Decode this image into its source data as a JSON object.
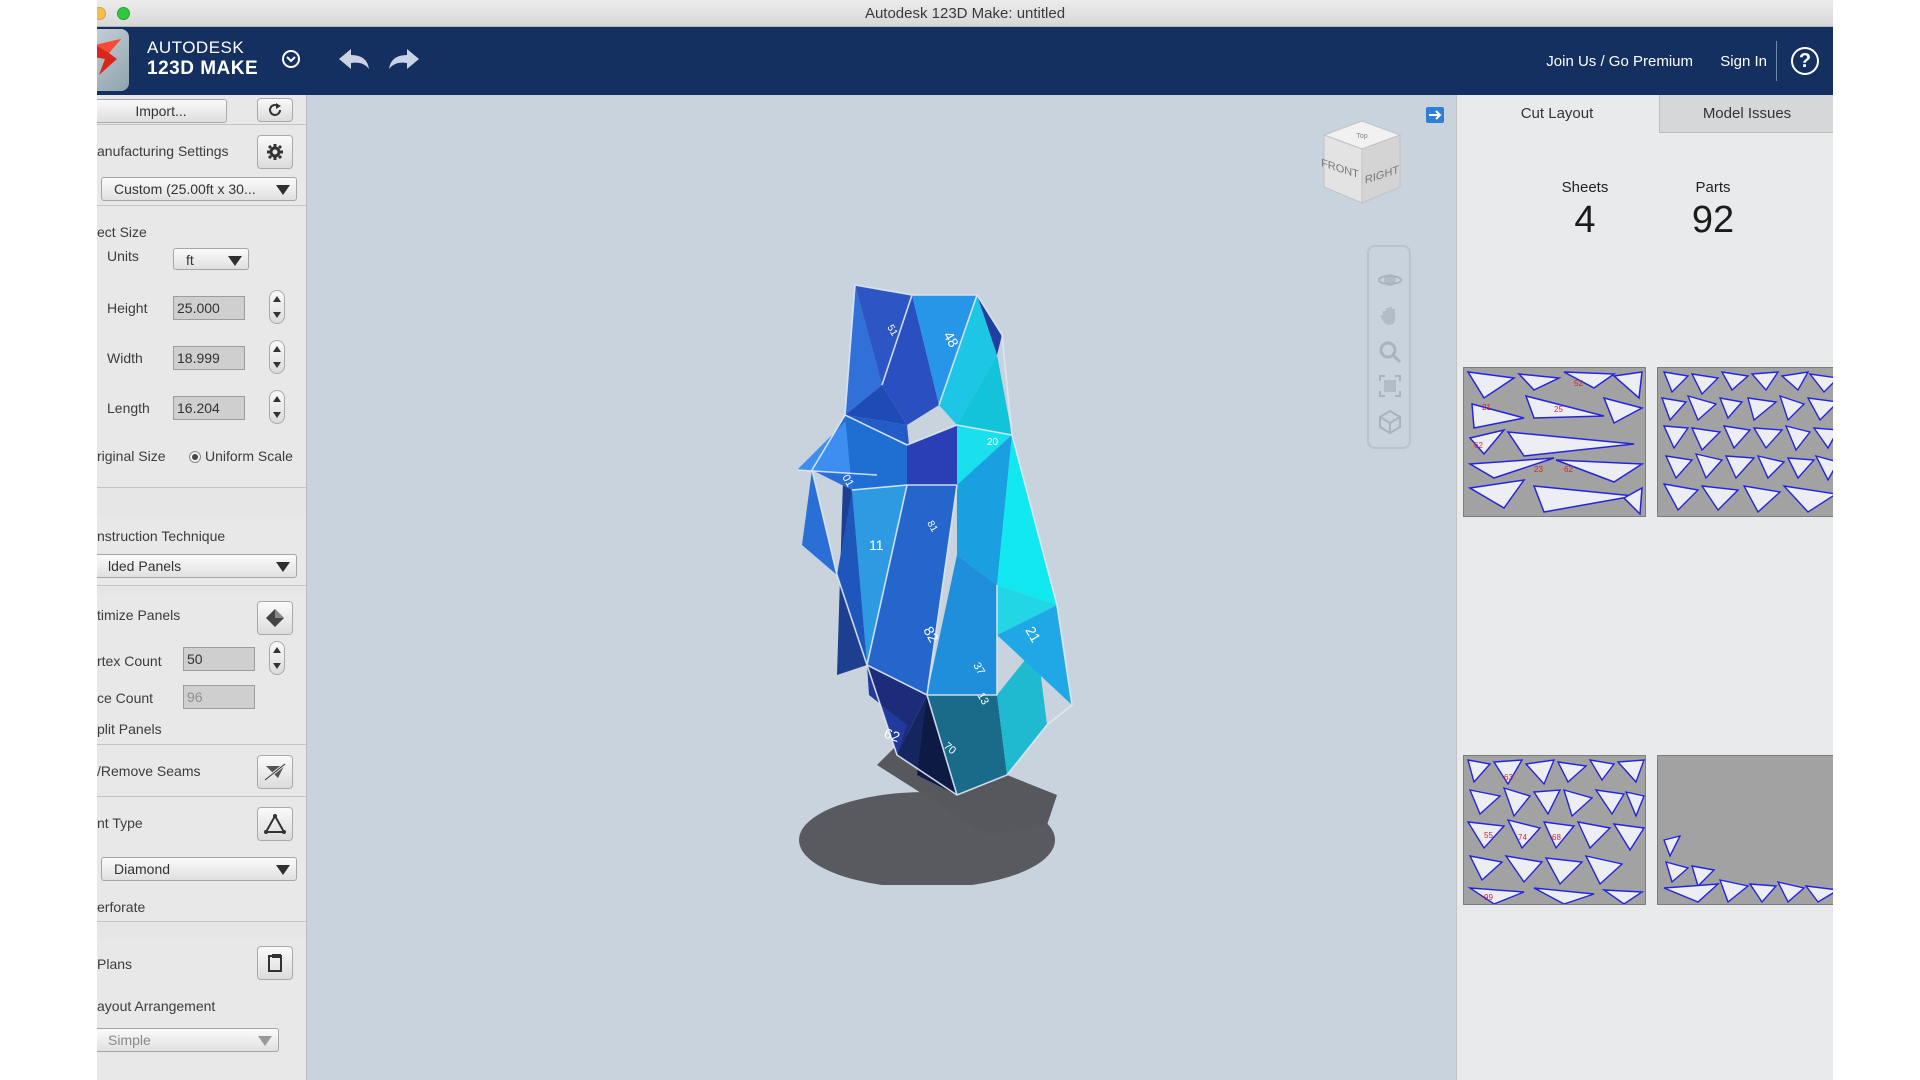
{
  "window": {
    "title": "Autodesk 123D Make: untitled"
  },
  "header": {
    "brand_top": "AUTODESK",
    "brand_bottom": "123D MAKE",
    "join_link": "Join Us / Go Premium",
    "signin_link": "Sign In",
    "help_label": "?"
  },
  "left_panel": {
    "import_button": "Import...",
    "manufacturing_label": "anufacturing Settings",
    "manufacturing_value": "Custom (25.00ft x 30...",
    "object_size_label": "ect Size",
    "units_label": "Units",
    "units_value": "ft",
    "height_label": "Height",
    "height_value": "25.000",
    "width_label": "Width",
    "width_value": "18.999",
    "length_label": "Length",
    "length_value": "16.204",
    "original_size_label": "riginal Size",
    "uniform_scale_label": "Uniform Scale",
    "construction_label": "nstruction Technique",
    "construction_value": "lded Panels",
    "optimize_label": "timize Panels",
    "vertex_count_label": "rtex Count",
    "vertex_count_value": "50",
    "face_count_label": "ce Count",
    "face_count_value": "96",
    "split_panels_label": "plit Panels",
    "seams_label": "/Remove Seams",
    "joint_type_label": "nt Type",
    "joint_type_value": "Diamond",
    "perforate_label": "erforate",
    "plans_label": "Plans",
    "layout_arrangement_label": "ayout Arrangement",
    "layout_arrangement_value": "Simple"
  },
  "viewport": {
    "viewcube_top": "Top",
    "viewcube_front": "FRONT",
    "viewcube_right": "RIGHT",
    "model_labels": [
      "48",
      "11",
      "82",
      "62",
      "21",
      "70",
      "01",
      "51",
      "20",
      "13",
      "37",
      "81"
    ]
  },
  "right_panel": {
    "tabs": [
      {
        "label": "Cut Layout",
        "active": true
      },
      {
        "label": "Model Issues",
        "active": false
      }
    ],
    "stats": {
      "sheets_label": "Sheets",
      "sheets_value": "4",
      "parts_label": "Parts",
      "parts_value": "92"
    }
  },
  "colors": {
    "header_bg": "#143061",
    "viewport_bg": "#c8d3de",
    "panel_bg": "#e6e6e6",
    "part_outline": "#2424e0",
    "part_number": "#e01f1f",
    "model_blue": "#2f6fd0",
    "model_cyan": "#19d6e8"
  },
  "icons": {
    "undo": "undo-arrow-icon",
    "redo": "redo-arrow-icon",
    "refresh": "refresh-icon",
    "settings": "gear-icon",
    "optimize": "diamond-shape-icon",
    "seams": "seam-tool-icon",
    "joint": "triangle-joint-icon",
    "plans": "document-icon",
    "orbit": "orbit-icon",
    "pan": "hand-pan-icon",
    "zoom": "zoom-icon",
    "fit": "fit-view-icon",
    "home": "home-cube-icon"
  }
}
